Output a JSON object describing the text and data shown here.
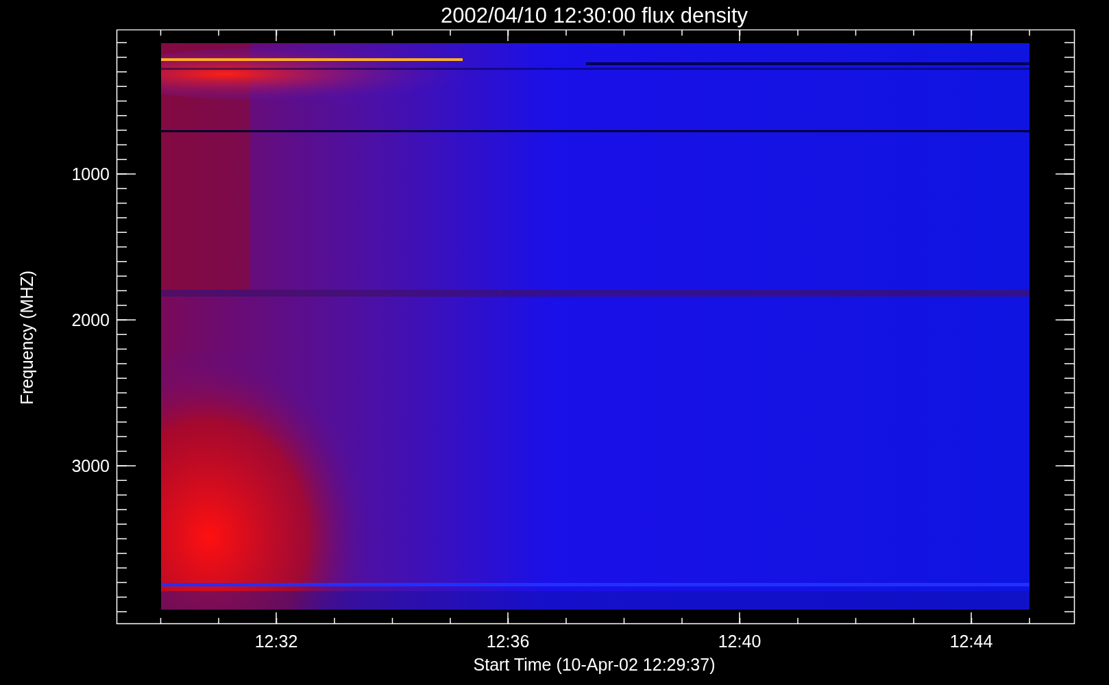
{
  "title": "2002/04/10 12:30:00 flux density",
  "x_axis": {
    "label": "Start Time (10-Apr-02 12:29:37)",
    "ticks": [
      "12:32",
      "12:36",
      "12:40",
      "12:44"
    ]
  },
  "y_axis": {
    "label": "Frequency (MHZ)",
    "ticks": [
      "1000",
      "2000",
      "3000"
    ]
  }
}
